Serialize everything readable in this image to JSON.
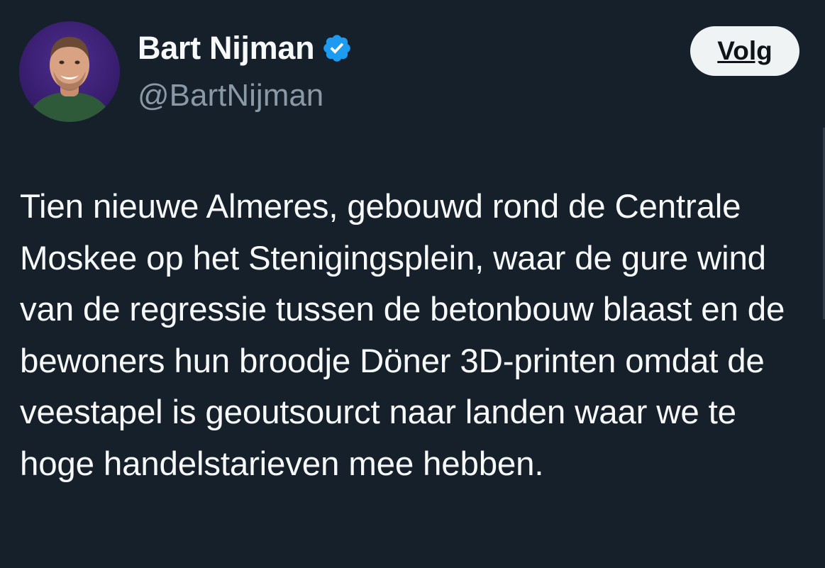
{
  "tweet": {
    "author": {
      "display_name": "Bart Nijman",
      "handle": "@BartNijman",
      "verified": true,
      "avatar_icon": "profile-photo"
    },
    "follow_label": "Volg",
    "text": "Tien nieuwe Almeres, gebouwd rond de Centrale Moskee op het Stenigingsplein, waar de gure wind van de regressie tussen de betonbouw blaast en de bewoners hun broodje Döner 3D-printen omdat de veestapel is geoutsourct naar landen waar we te hoge handelstarieven mee hebben."
  },
  "colors": {
    "background": "#15202b",
    "text_primary": "#f7f9f9",
    "text_secondary": "#8b98a5",
    "verified_blue": "#1d9bf0",
    "button_bg": "#eff3f4",
    "button_text": "#0f1419"
  }
}
